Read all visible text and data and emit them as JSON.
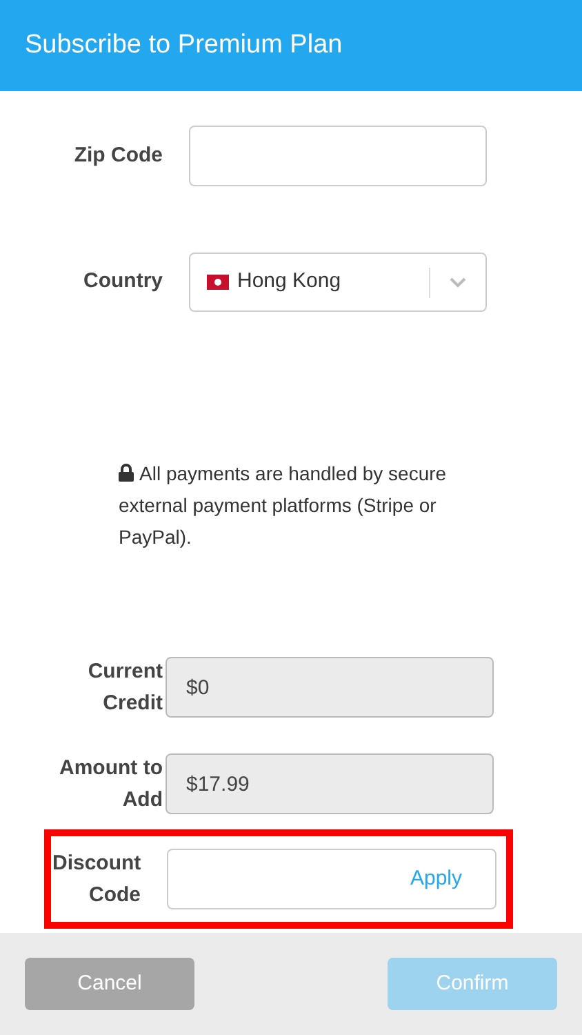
{
  "header": {
    "title": "Subscribe to Premium Plan"
  },
  "zip_code": {
    "label": "Zip Code"
  },
  "country": {
    "label": "Country",
    "value": "Hong Kong"
  },
  "notice": "All payments are handled by secure external payment platforms (Stripe or PayPal).",
  "current_credit": {
    "label": "Current Credit",
    "value": "$0",
    "disabled": true
  },
  "amount_to_add": {
    "label": "Amount to Add",
    "value": "$17.99",
    "disabled": true
  },
  "discount_code": {
    "label": "Discount Code",
    "action": "Apply",
    "highlighted": true
  },
  "footer": {
    "buttons": [
      {
        "label": "Cancel",
        "kind": "cancel",
        "disabled": false
      },
      {
        "label": "Confirm",
        "kind": "confirm",
        "disabled": true
      }
    ]
  }
}
